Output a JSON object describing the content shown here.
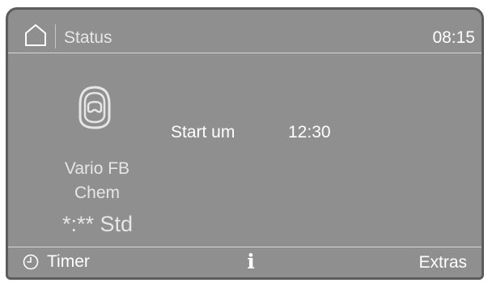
{
  "header": {
    "title": "Status",
    "time": "08:15",
    "home_icon": "home-icon"
  },
  "program": {
    "icon": "mask-icon",
    "name_line1": "Vario FB",
    "name_line2": "Chem",
    "duration": "*:** Std"
  },
  "start": {
    "label": "Start um",
    "time": "12:30"
  },
  "footer": {
    "timer_label": "Timer",
    "timer_icon": "clock-icon",
    "info_label": "i",
    "extras_label": "Extras"
  },
  "colors": {
    "screen_bg": "#8f8f8f",
    "text": "#ffffff",
    "divider": "#d8d8d8"
  }
}
